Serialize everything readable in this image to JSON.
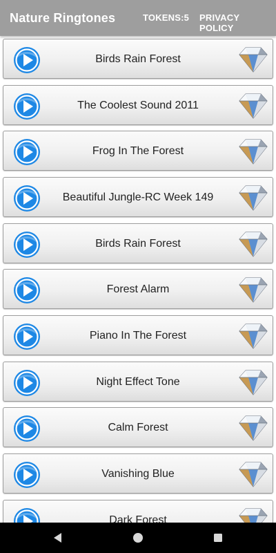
{
  "app_bar": {
    "title": "Nature Ringtones",
    "tokens_label": "TOKENS:5",
    "privacy_label": "PRIVACY POLICY",
    "background": "#9e9e9e"
  },
  "ringtones": [
    {
      "title": "Birds Rain Forest"
    },
    {
      "title": "The Coolest Sound 2011"
    },
    {
      "title": "Frog In The Forest"
    },
    {
      "title": "Beautiful Jungle-RC Week 149"
    },
    {
      "title": "Birds Rain Forest"
    },
    {
      "title": "Forest Alarm"
    },
    {
      "title": "Piano In The Forest"
    },
    {
      "title": "Night Effect Tone"
    },
    {
      "title": "Calm Forest"
    },
    {
      "title": "Vanishing Blue"
    },
    {
      "title": "Dark Forest"
    }
  ],
  "icons": {
    "play": "play-button-icon",
    "premium": "diamond-icon",
    "nav_back": "back-triangle-icon",
    "nav_home": "home-circle-icon",
    "nav_recent": "recent-apps-square-icon"
  },
  "colors": {
    "play_blue": "#1e88e5",
    "row_border": "#9c9c9c",
    "nav_bar": "#000000"
  }
}
